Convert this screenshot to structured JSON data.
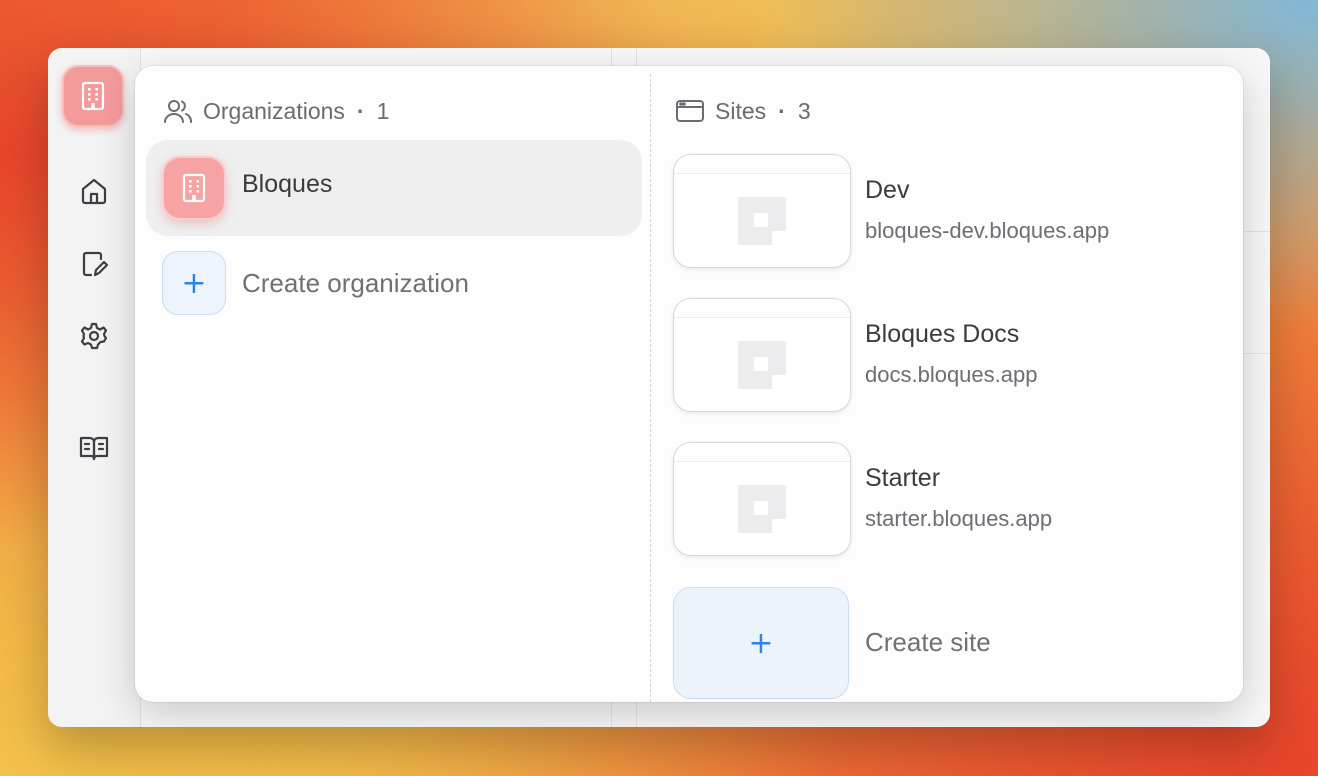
{
  "organizations": {
    "title": "Organizations",
    "separator": "·",
    "count": "1",
    "items": [
      {
        "name": "Bloques"
      }
    ],
    "create_label": "Create organization",
    "create_symbol": "+"
  },
  "sites": {
    "title": "Sites",
    "separator": "·",
    "count": "3",
    "items": [
      {
        "name": "Dev",
        "url": "bloques-dev.bloques.app"
      },
      {
        "name": "Bloques Docs",
        "url": "docs.bloques.app"
      },
      {
        "name": "Starter",
        "url": "starter.bloques.app"
      }
    ],
    "create_label": "Create site",
    "create_symbol": "+"
  },
  "sidebar": {
    "icons": [
      "building-icon",
      "home-icon",
      "edit-document-icon",
      "settings-gear-icon",
      "book-icon"
    ]
  },
  "colors": {
    "org_accent": "#f8a3a3",
    "create_accent": "#2f86e0"
  }
}
